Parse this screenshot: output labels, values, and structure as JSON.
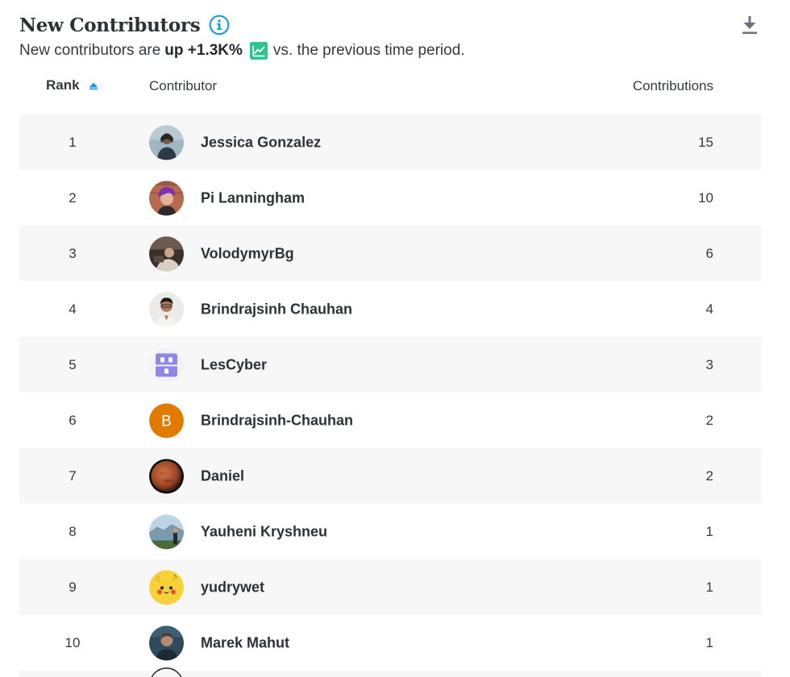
{
  "header": {
    "title": "New Contributors",
    "subtitle_prefix": "New contributors are",
    "subtitle_bold": "up +1.3K%",
    "subtitle_suffix": "vs. the previous time period.",
    "info_icon": "info-icon",
    "trend_icon": "trend-up-icon",
    "download_icon": "download-icon"
  },
  "colors": {
    "accent": "#1a9bdc",
    "trend": "#2bc48a",
    "row_alt": "#f7f7f7"
  },
  "table": {
    "columns": {
      "rank": "Rank",
      "contributor": "Contributor",
      "contributions": "Contributions"
    },
    "sort": "rank-ascending",
    "rows": [
      {
        "rank": "1",
        "name": "Jessica Gonzalez",
        "contributions": "15",
        "avatar": "photo"
      },
      {
        "rank": "2",
        "name": "Pi Lanningham",
        "contributions": "10",
        "avatar": "photo"
      },
      {
        "rank": "3",
        "name": "VolodymyrBg",
        "contributions": "6",
        "avatar": "photo"
      },
      {
        "rank": "4",
        "name": "Brindrajsinh Chauhan",
        "contributions": "4",
        "avatar": "photo"
      },
      {
        "rank": "5",
        "name": "LesCyber",
        "contributions": "3",
        "avatar": "logo"
      },
      {
        "rank": "6",
        "name": "Brindrajsinh-Chauhan",
        "contributions": "2",
        "avatar": "initial",
        "initial": "B",
        "avatar_color": "#e07b00"
      },
      {
        "rank": "7",
        "name": "Daniel",
        "contributions": "2",
        "avatar": "photo"
      },
      {
        "rank": "8",
        "name": "Yauheni Kryshneu",
        "contributions": "1",
        "avatar": "photo"
      },
      {
        "rank": "9",
        "name": "yudrywet",
        "contributions": "1",
        "avatar": "photo"
      },
      {
        "rank": "10",
        "name": "Marek Mahut",
        "contributions": "1",
        "avatar": "photo"
      }
    ]
  }
}
